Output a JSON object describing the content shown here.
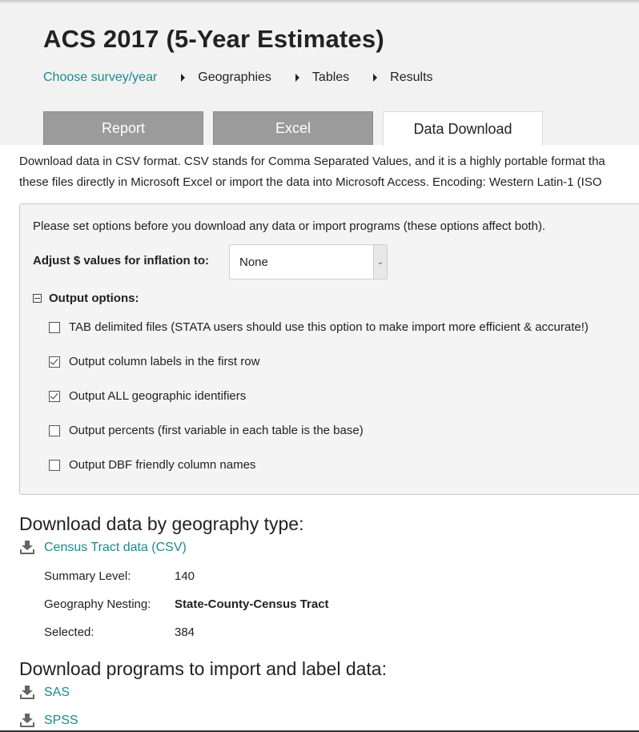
{
  "header": {
    "title": "ACS 2017 (5-Year Estimates)",
    "breadcrumbs": [
      "Choose survey/year",
      "Geographies",
      "Tables",
      "Results"
    ],
    "tabs": [
      "Report",
      "Excel",
      "Data Download"
    ],
    "active_tab": "Data Download"
  },
  "description": {
    "line1": "Download data in CSV format. CSV stands for Comma Separated Values, and it is a highly portable format tha",
    "line2": "these files directly in Microsoft Excel or import the data into Microsoft Access. Encoding: Western Latin-1 (ISO"
  },
  "options": {
    "intro": "Please set options before you download any data or import programs (these options affect both).",
    "inflation_label": "Adjust $ values for inflation to:",
    "inflation_value": "None",
    "output_heading": "Output options:",
    "items": [
      {
        "label": "TAB delimited files (STATA users should use this option to make import more efficient & accurate!)",
        "checked": false
      },
      {
        "label": "Output column labels in the first row",
        "checked": true
      },
      {
        "label": "Output ALL geographic identifiers",
        "checked": true
      },
      {
        "label": "Output percents (first variable in each table is the base)",
        "checked": false
      },
      {
        "label": "Output DBF friendly column names",
        "checked": false
      }
    ]
  },
  "geography": {
    "heading": "Download data by geography type:",
    "link": "Census Tract data (CSV)",
    "summary_level_label": "Summary Level:",
    "summary_level_value": "140",
    "nesting_label": "Geography Nesting:",
    "nesting_value": "State-County-Census Tract",
    "selected_label": "Selected:",
    "selected_value": "384"
  },
  "programs": {
    "heading": "Download programs to import and label data:",
    "links": [
      "SAS",
      "SPSS"
    ]
  },
  "colors": {
    "link": "#1a8a8f",
    "tab_inactive": "#9b9b9b",
    "header_bg": "#f2f2f2"
  }
}
